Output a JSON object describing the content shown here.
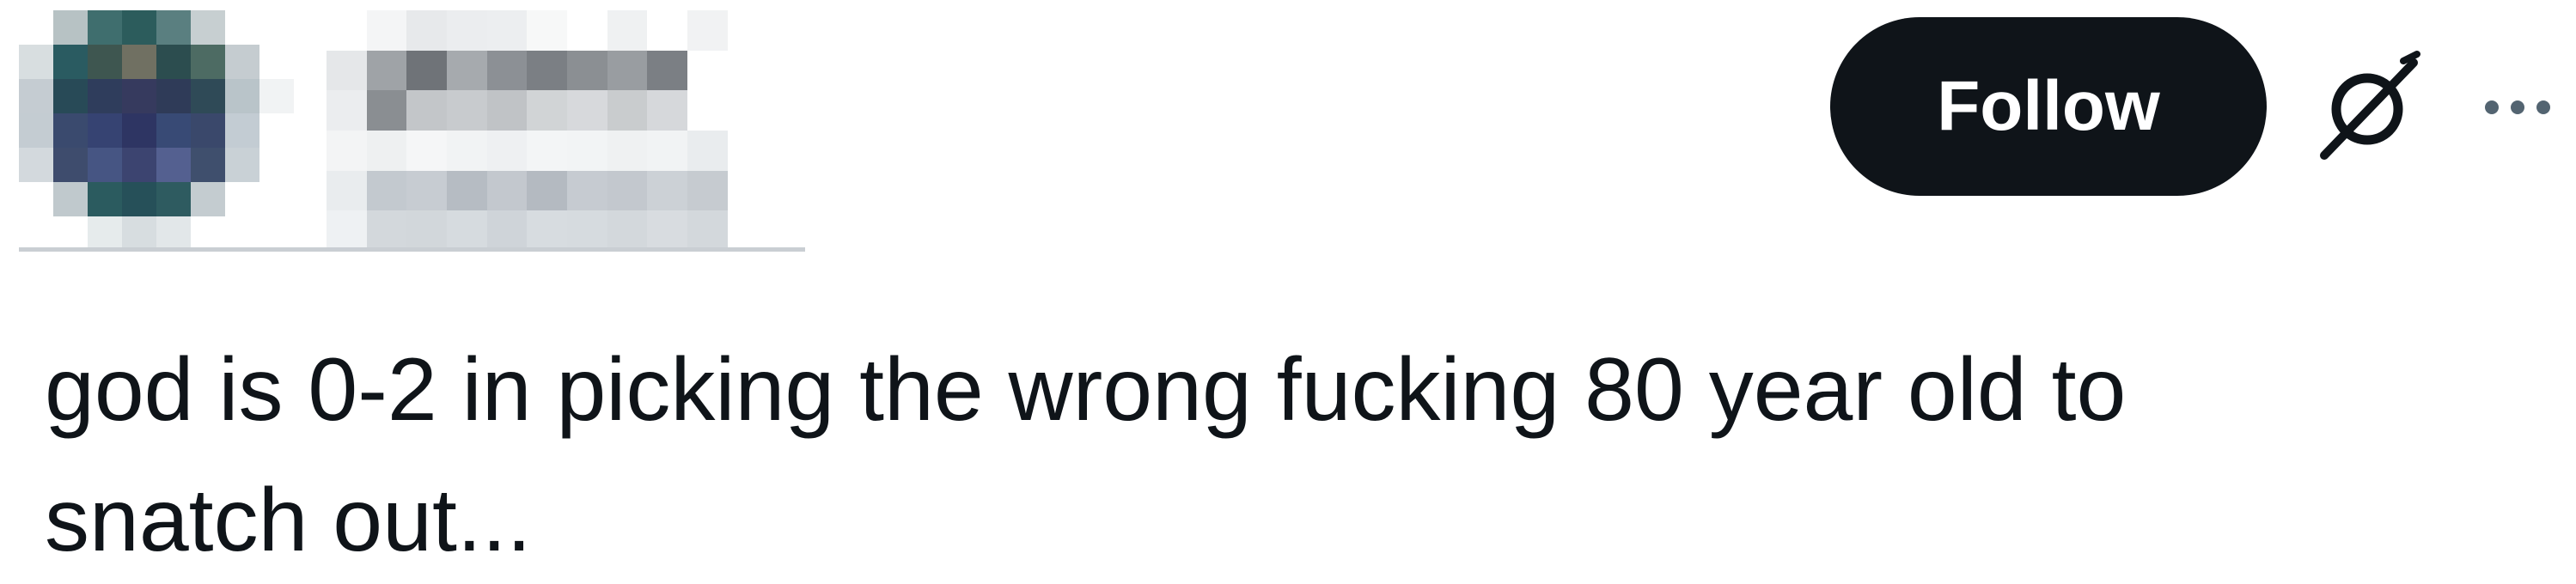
{
  "author": {
    "avatar_icon": "pixelated-avatar",
    "name_redacted": true
  },
  "actions": {
    "follow_label": "Follow",
    "grok_icon": "grok-slash-circle-icon",
    "more_icon": "more-horizontal-icon"
  },
  "tweet": {
    "text": "god is 0-2 in picking the wrong fucking 80 year old to\nsnatch out..."
  },
  "colors": {
    "text": "#0f1419",
    "button_bg": "#0f1419",
    "button_text": "#ffffff",
    "background": "#ffffff"
  }
}
